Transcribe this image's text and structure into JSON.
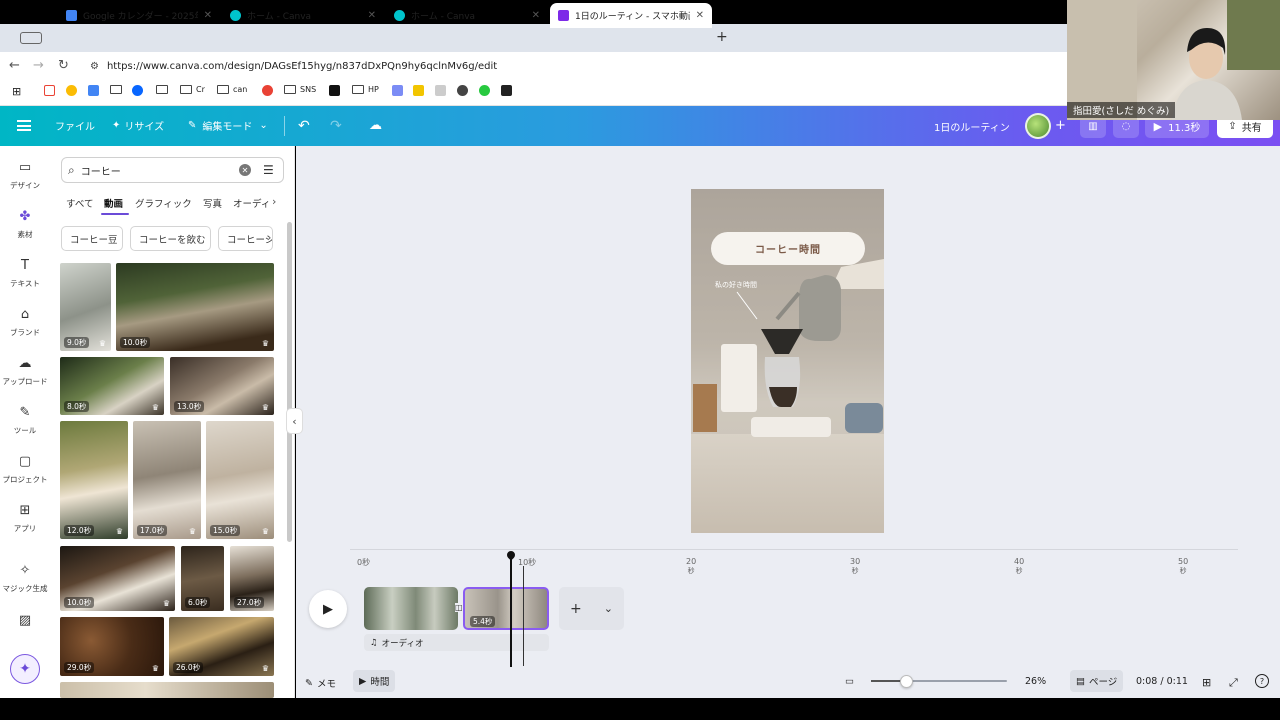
{
  "browser": {
    "tabs": [
      {
        "title": "Google カレンダー - 2025年 7",
        "favicon_color": "#4285f4"
      },
      {
        "title": "ホーム - Canva",
        "favicon_color": "#00c4cc"
      },
      {
        "title": "ホーム - Canva",
        "favicon_color": "#00c4cc"
      },
      {
        "title": "1日のルーティン - スマホ動画",
        "favicon_color": "#7d2ae8"
      }
    ],
    "url": "https://www.canva.com/design/DAGsEf15hyg/n837dDxPQn9hy6qclnMv6g/edit",
    "bookmarks": [
      {
        "label": "",
        "icon": "gmail-icon",
        "color": "#ea4335"
      },
      {
        "label": "",
        "icon": "photos-icon",
        "color": "#fbbc04"
      },
      {
        "label": "",
        "icon": "calendar-icon",
        "color": "#4285f4"
      },
      {
        "label": "",
        "icon": "folder-icon"
      },
      {
        "label": "",
        "icon": "meta-icon",
        "color": "#0866ff"
      },
      {
        "label": "",
        "icon": "folder-icon"
      },
      {
        "label": "Cr",
        "icon": "folder-icon"
      },
      {
        "label": "can",
        "icon": "folder-icon"
      },
      {
        "label": "",
        "icon": "chrome-icon",
        "color": "#e94235"
      },
      {
        "label": "SNS",
        "icon": "folder-icon"
      },
      {
        "label": "",
        "icon": "notion-icon",
        "color": "#111111"
      },
      {
        "label": "HP",
        "icon": "folder-icon"
      },
      {
        "label": "",
        "icon": "app-icon",
        "color": "#7b8cf5"
      },
      {
        "label": "",
        "icon": "app-icon",
        "color": "#f2c500"
      },
      {
        "label": "",
        "icon": "app-icon",
        "color": "#cccccc"
      },
      {
        "label": "",
        "icon": "app-icon",
        "color": "#444444"
      },
      {
        "label": "",
        "icon": "app-icon",
        "color": "#27c93f"
      },
      {
        "label": "",
        "icon": "app-icon",
        "color": "#222222"
      }
    ]
  },
  "header": {
    "file": "ファイル",
    "resize": "リサイズ",
    "edit_mode": "編集モード",
    "doc_title": "1日のルーティン",
    "duration_btn": "11.3秒",
    "share": "共有",
    "gradient_start": "#00b6c5",
    "gradient_end": "#7b4ff2"
  },
  "rail": {
    "items": [
      {
        "label": "デザイン",
        "icon": "design-icon"
      },
      {
        "label": "素材",
        "icon": "elements-icon"
      },
      {
        "label": "テキスト",
        "icon": "text-icon"
      },
      {
        "label": "ブランド",
        "icon": "brand-icon"
      },
      {
        "label": "アップロード",
        "icon": "upload-icon"
      },
      {
        "label": "ツール",
        "icon": "tools-icon"
      },
      {
        "label": "プロジェクト",
        "icon": "projects-icon"
      },
      {
        "label": "アプリ",
        "icon": "apps-icon"
      },
      {
        "label": "マジック生成",
        "icon": "magic-media-icon"
      },
      {
        "label": "",
        "icon": "image-icon"
      }
    ]
  },
  "panel": {
    "search_value": "コーヒー",
    "categories": [
      "すべて",
      "動画",
      "グラフィック",
      "写真",
      "オーディ"
    ],
    "active_category": "動画",
    "chips": [
      "コーヒー豆",
      "コーヒーを飲む",
      "コーヒーシ"
    ],
    "durations": [
      "9.0秒",
      "10.0秒",
      "8.0秒",
      "13.0秒",
      "12.0秒",
      "17.0秒",
      "15.0秒",
      "10.0秒",
      "6.0秒",
      "27.0秒",
      "29.0秒",
      "26.0秒"
    ]
  },
  "canvas": {
    "title_text": "コーヒー時間",
    "caption": "私の好き時間"
  },
  "timeline": {
    "ticks": [
      {
        "value": "0秒",
        "unit": ""
      },
      {
        "value": "10秒",
        "unit": ""
      },
      {
        "value": "20",
        "unit": "秒"
      },
      {
        "value": "30",
        "unit": "秒"
      },
      {
        "value": "40",
        "unit": "秒"
      },
      {
        "value": "50",
        "unit": "秒"
      }
    ],
    "clip2_duration": "5.4秒",
    "audio_label": "オーディオ",
    "accent": "#8a5cf0"
  },
  "footer": {
    "notes": "メモ",
    "timer": "時間",
    "zoom": "26%",
    "zoom_fraction": 0.26,
    "pages": "ページ",
    "time": "0:08 / 0:11"
  },
  "webcam": {
    "name": "指田愛(さしだ めぐみ)"
  }
}
